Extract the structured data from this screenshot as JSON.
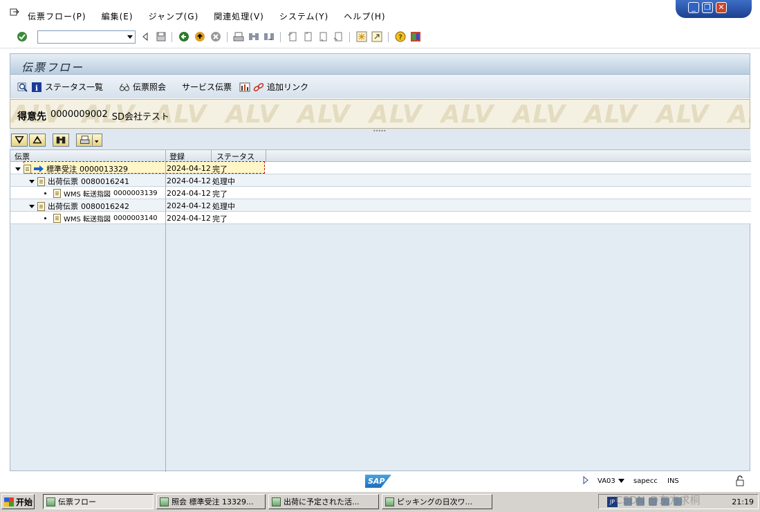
{
  "menu": [
    "伝票フロー(P)",
    "編集(E)",
    "ジャンプ(G)",
    "関連処理(V)",
    "システム(Y)",
    "ヘルプ(H)"
  ],
  "window_controls": [
    "_",
    "❐",
    "✕"
  ],
  "screen_title": "伝票フロー",
  "app_toolbar": {
    "status_overview": "ステータス一覧",
    "display_document": "伝票照会",
    "service_document": "サービス伝票",
    "additional_links": "追加リンク"
  },
  "header": {
    "label": "得意先",
    "customer_number": "0000009002",
    "customer_name": "SD会社テスト",
    "watermark": "ALV"
  },
  "columns": [
    "伝票",
    "登録",
    "ステータス"
  ],
  "rows": [
    {
      "title": "標準受注",
      "number": "0000013329",
      "date": "2024-04-12",
      "status": "完了"
    },
    {
      "title": "出荷伝票",
      "number": "0080016241",
      "date": "2024-04-12",
      "status": "処理中"
    },
    {
      "title": "WMS 転送指図",
      "number": "0000003139",
      "date": "2024-04-12",
      "status": "完了"
    },
    {
      "title": "出荷伝票",
      "number": "0080016242",
      "date": "2024-04-12",
      "status": "処理中"
    },
    {
      "title": "WMS 転送指図",
      "number": "0000003140",
      "date": "2024-04-12",
      "status": "完了"
    }
  ],
  "status_bar": {
    "logo": "SAP",
    "transaction": "VA03",
    "system": "sapecc",
    "mode": "INS"
  },
  "taskbar": {
    "start": "开始",
    "tasks": [
      "伝票フロー",
      "照会 標準受注 13329...",
      "出荷に予定された活...",
      "ピッキングの日次ワ..."
    ],
    "ime": "JP",
    "clock": "21:19",
    "watermark": "CSDN @东方求桐"
  },
  "colors": {
    "title_bar": "#b9cddf",
    "alv_header_bg": "#f5f1e2",
    "selected_row": "#fff6c8",
    "arrow": "#1a5fd0"
  }
}
